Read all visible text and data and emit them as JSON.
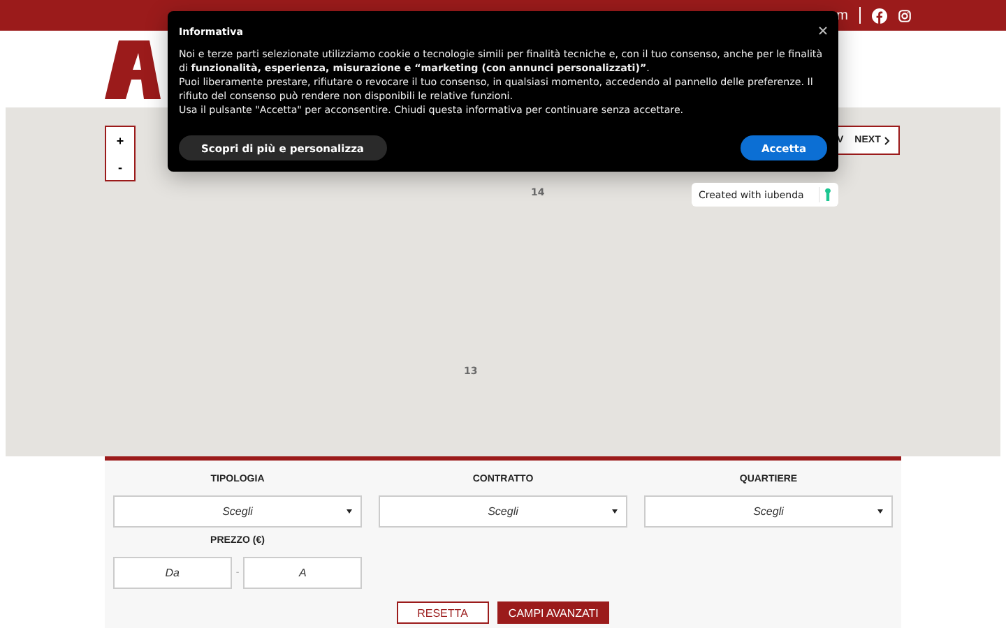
{
  "top_bar": {
    "text": "m"
  },
  "map": {
    "zoom_in": "+",
    "zoom_out": "-",
    "prev": "V",
    "next": "NEXT",
    "labels": [
      "14",
      "13"
    ]
  },
  "search_form": {
    "fields": [
      {
        "label": "TIPOLOGIA",
        "value": "Scegli"
      },
      {
        "label": "CONTRATTO",
        "value": "Scegli"
      },
      {
        "label": "QUARTIERE",
        "value": "Scegli"
      }
    ],
    "price": {
      "label": "PREZZO (€)",
      "from_placeholder": "Da",
      "separator": "-",
      "to_placeholder": "A"
    },
    "buttons": [
      {
        "label": "RESETTA",
        "kind": "outline"
      },
      {
        "label": "CAMPI AVANZATI",
        "kind": "filled"
      }
    ]
  },
  "cookie_dialog": {
    "title": "Informativa",
    "paragraphs": [
      "Noi e terze parti selezionate utilizziamo cookie o tecnologie simili per finalità tecniche e, con il tuo consenso, anche per le finalità di **funzionalità, esperienza, misurazione e “marketing (con annunci personalizzati)”**.",
      "Puoi liberamente prestare, rifiutare o revocare il tuo consenso, in qualsiasi momento, accedendo al pannello delle preferenze. Il rifiuto del consenso può rendere non disponibili le relative funzioni.",
      "Usa il pulsante \"Accetta\" per acconsentire. Chiudi questa informativa per continuare senza accettare."
    ],
    "customize": "Scopri di più e personalizza",
    "accept": "Accetta"
  },
  "badge": {
    "text": "Created with",
    "link": "iubenda"
  }
}
